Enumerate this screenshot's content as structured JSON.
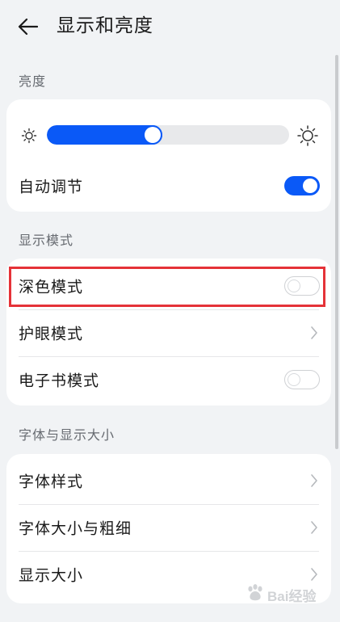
{
  "header": {
    "title": "显示和亮度",
    "back_icon": "arrow-left-icon"
  },
  "sections": {
    "brightness": "亮度",
    "display_mode": "显示模式",
    "font_and_size": "字体与显示大小"
  },
  "brightness": {
    "level_fraction": 0.475,
    "auto_adjust_label": "自动调节",
    "auto_adjust_on": true,
    "min_icon": "sun-small-icon",
    "max_icon": "sun-large-icon"
  },
  "display_mode": {
    "dark_mode_label": "深色模式",
    "dark_mode_on": false,
    "eye_comfort_label": "护眼模式",
    "ebook_mode_label": "电子书模式",
    "ebook_mode_on": false
  },
  "font": {
    "font_style_label": "字体样式",
    "font_size_weight_label": "字体大小与粗细",
    "display_size_label": "显示大小"
  },
  "watermark": {
    "text": "Bai经验"
  },
  "colors": {
    "accent": "#0a59f7",
    "background": "#f1f3f5",
    "card": "#ffffff",
    "highlight": "#e53238"
  }
}
